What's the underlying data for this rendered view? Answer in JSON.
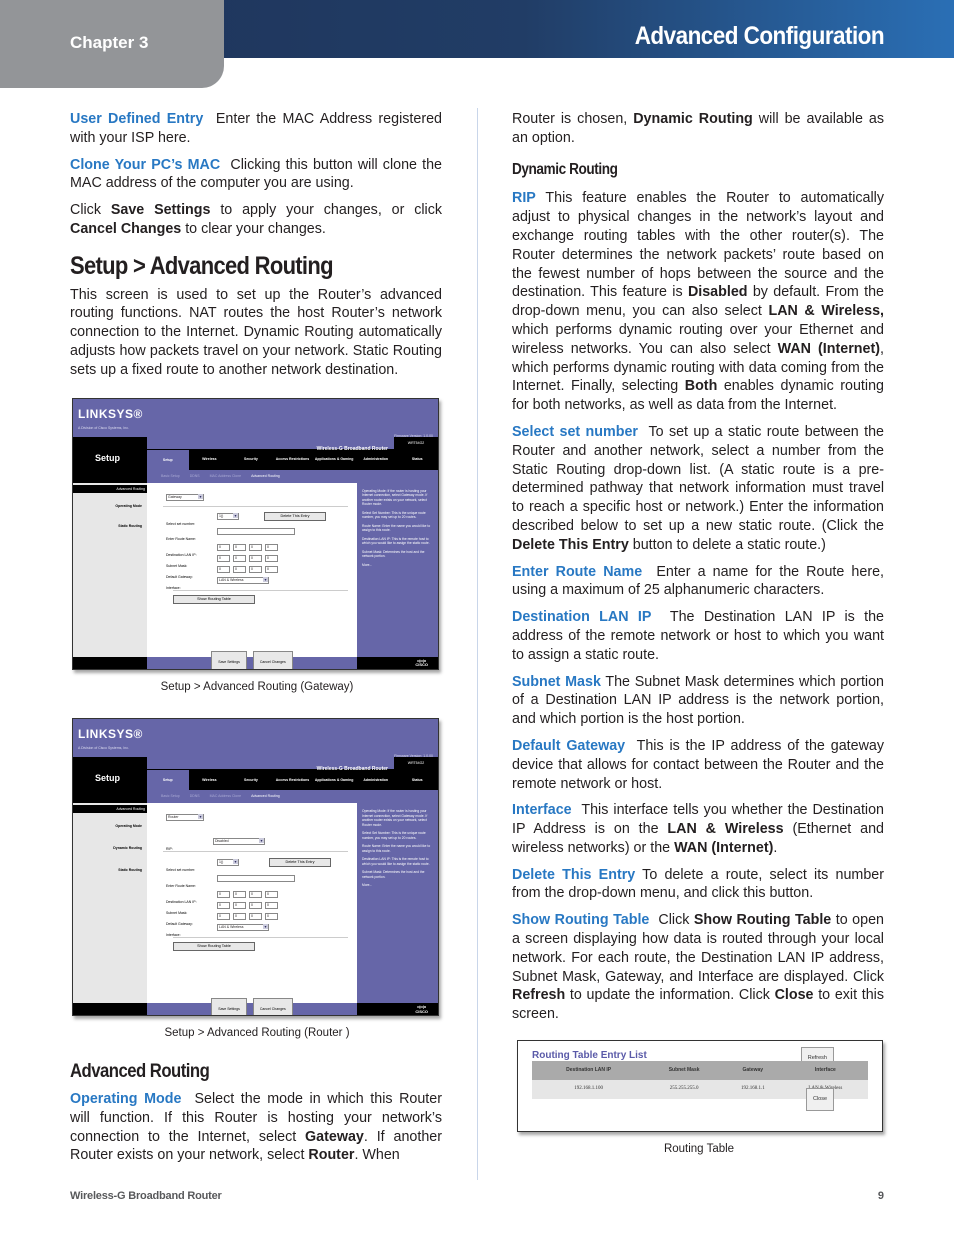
{
  "header": {
    "chapter": "Chapter 3",
    "title": "Advanced Configuration"
  },
  "left_column": {
    "user_defined_entry": {
      "term": "User Defined Entry",
      "text": "Enter the MAC Address registered with your ISP here."
    },
    "clone_mac": {
      "term": "Clone Your PC’s MAC",
      "text": "Clicking this button will clone the MAC address of the computer you are using."
    },
    "save_note": {
      "pre": "Click ",
      "b1": "Save Settings",
      "mid": " to apply your changes, or click ",
      "b2": "Cancel Changes",
      "post": " to clear your changes."
    },
    "section_title": "Setup > Advanced Routing",
    "intro": "This screen is used to set up the Router’s advanced routing functions. NAT routes the host Router’s network connection to the Internet. Dynamic Routing automatically adjusts how packets travel on your network. Static Routing sets up a fixed route to another network destination.",
    "subsection_title": "Advanced Routing",
    "operating_mode": {
      "term": "Operating Mode",
      "pre": "Select the mode in which this Router will function. If this Router is hosting your network’s connection to the Internet, select ",
      "b1": "Gateway",
      "mid": ". If another Router exists on your network, select ",
      "b2": "Router",
      "post": ". When"
    }
  },
  "figures": {
    "gateway": {
      "caption": "Setup > Advanced Routing (Gateway)",
      "operating_mode_value": "Gateway"
    },
    "router": {
      "caption": "Setup > Advanced Routing (Router )",
      "operating_mode_value": "Router",
      "rip_value": "Disabled"
    },
    "linksys": {
      "logo": "LINKSYS®",
      "logo_sub": "A Division of Cisco Systems, Inc.",
      "firmware": "Firmware Version: 1.0.00",
      "section": "Setup",
      "product": "Wireless-G Broadband Router",
      "model": "WRT54G2",
      "tabs": [
        "Setup",
        "Wireless",
        "Security",
        "Access Restrictions",
        "Applications & Gaming",
        "Administration",
        "Status"
      ],
      "subtabs": [
        "Basic Setup",
        "DDNS",
        "MAC Address Clone",
        "Advanced Routing"
      ],
      "side_head": "Advanced Routing",
      "side_operating_mode": "Operating Mode",
      "side_dynamic_routing": "Dynamic Routing",
      "side_static_routing": "Static Routing",
      "rip_label": "RIP:",
      "select_set_label": "Select set number:",
      "select_set_value": "1()",
      "delete_entry": "Delete This Entry",
      "route_name_label": "Enter Route Name:",
      "dest_ip_label": "Destination LAN IP:",
      "subnet_label": "Subnet Mask:",
      "gateway_label": "Default Gateway:",
      "interface_label": "Interface:",
      "interface_value": "LAN & Wireless",
      "octets": [
        "0",
        "0",
        "0",
        "0"
      ],
      "show_routing_table": "Show Routing Table",
      "save_settings": "Save Settings",
      "cancel_changes": "Cancel Changes",
      "cisco": "CISCO",
      "help": [
        "Operating Mode: If the router is hosting your Internet connection, select Gateway mode. If another router exists on your network, select Router mode.",
        "Select Set Number: This is the unique route number, you may set up to 20 routes.",
        "Route Name: Enter the name you would like to assign to this route.",
        "Destination LAN IP: This is the remote host to which you would like to assign the static route.",
        "Subnet Mask: Determines the host and the network portion.",
        "More..."
      ]
    }
  },
  "right_column": {
    "cont": {
      "pre": "Router is chosen, ",
      "b1": "Dynamic Routing",
      "post": " will be available as an option."
    },
    "dynamic_title": "Dynamic Routing",
    "rip": {
      "term": "RIP",
      "t1": " This feature enables the Router to automatically adjust to physical changes in the network’s layout and exchange routing tables with the other router(s). The Router determines the network packets’ route based on the fewest number of hops between the source and the destination. This feature is ",
      "b1": "Disabled",
      "t2": " by default. From the drop-down menu, you can also select ",
      "b2": "LAN & Wireless,",
      "t3": " which performs dynamic routing over your Ethernet and wireless networks. You can also select ",
      "b3": "WAN (Internet)",
      "t4": ", which performs dynamic routing with data coming from the Internet. Finally, selecting ",
      "b4": "Both",
      "t5": " enables dynamic routing for both networks, as well as data from the Internet."
    },
    "select_set": {
      "term": "Select set number",
      "t1": "To set up a static route between the Router and another network, select a number from the Static Routing drop-down list. (A static route is a pre-determined pathway that network information must travel to reach a specific host or network.) Enter the information described below to set up a new static route. (Click the ",
      "b1": "Delete This Entry",
      "t2": " button to delete a static route.)"
    },
    "route_name": {
      "term": "Enter Route Name",
      "text": "Enter a name for the Route here, using a maximum of 25 alphanumeric characters."
    },
    "dest_ip": {
      "term": "Destination LAN IP",
      "text": "The Destination LAN IP is the address of the remote network or host to which you want to assign a static route."
    },
    "subnet": {
      "term": "Subnet Mask",
      "text": "The Subnet Mask determines which portion of a Destination LAN IP address is the network portion, and which portion is the host portion."
    },
    "default_gw": {
      "term": "Default Gateway",
      "text": "This is the IP address of the gateway device that allows for contact between the Router and the remote network or host."
    },
    "interface": {
      "term": "Interface",
      "t1": "This interface tells you whether the Destination IP Address is on the ",
      "b1": "LAN & Wireless",
      "t2": " (Ethernet and wireless networks) or the ",
      "b2": "WAN (Internet)",
      "t3": "."
    },
    "delete_entry": {
      "term": "Delete This Entry",
      "text": "To delete a route, select its number from the drop-down menu, and click this button."
    },
    "show_table": {
      "term": "Show Routing Table",
      "t1": "Click ",
      "b1": "Show Routing Table",
      "t2": " to open a screen displaying how data is routed through your local network. For each route, the Destination LAN IP address, Subnet Mask, Gateway, and Interface are displayed. Click ",
      "b2": "Refresh",
      "t3": " to update the information. Click ",
      "b3": "Close",
      "t4": " to exit this screen."
    },
    "routing_table": {
      "title": "Routing Table Entry List",
      "refresh": "Refresh",
      "close": "Close",
      "headers": [
        "Destination LAN IP",
        "Subnet Mask",
        "Gateway",
        "Interface"
      ],
      "rows": [
        [
          "192.168.1.100",
          "255.255.255.0",
          "192.168.1.1",
          "LAN & Wireless"
        ]
      ],
      "caption": "Routing Table"
    }
  },
  "footer": {
    "product": "Wireless-G Broadband Router",
    "page": "9"
  }
}
